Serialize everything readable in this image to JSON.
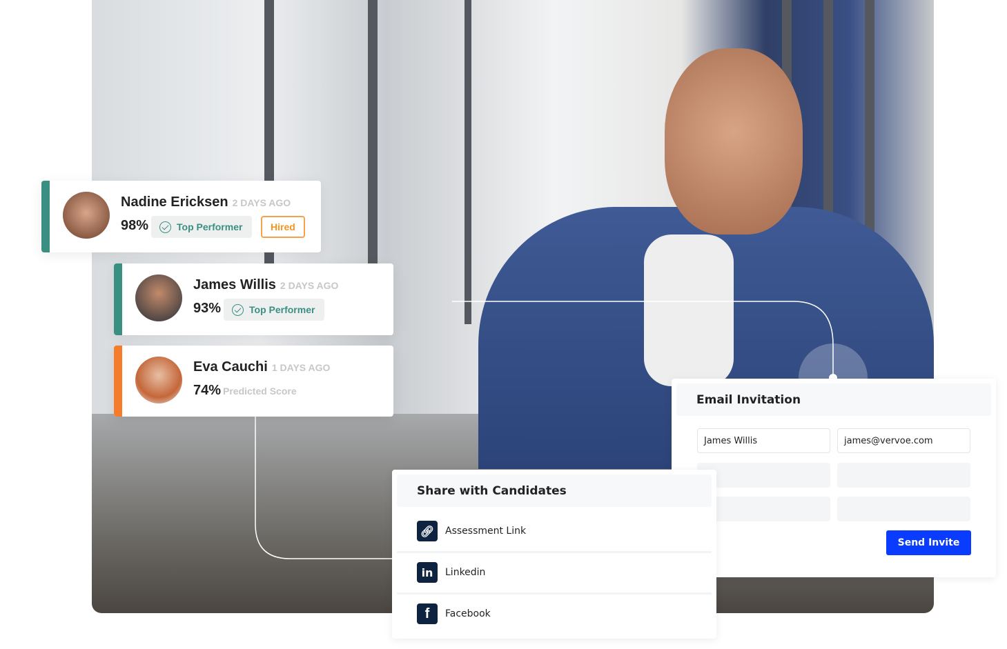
{
  "colors": {
    "teal": "#3a8f82",
    "orange": "#f57c2b",
    "hired": "#f7931e",
    "primary": "#0a3cff",
    "icon_bg": "#0d2340"
  },
  "candidates": [
    {
      "name": "Nadine Ericksen",
      "ago": "2 DAYS AGO",
      "score": "98%",
      "badge": "Top Performer",
      "status": "Hired",
      "accent": "#3a8f82"
    },
    {
      "name": "James Willis",
      "ago": "2 DAYS AGO",
      "score": "93%",
      "badge": "Top Performer",
      "accent": "#3a8f82"
    },
    {
      "name": "Eva Cauchi",
      "ago": "1 DAYS AGO",
      "score": "74%",
      "label": "Predicted Score",
      "accent": "#f57c2b"
    }
  ],
  "email": {
    "title": "Email Invitation",
    "name_value": "James Willis",
    "email_value": "james@vervoe.com",
    "send_label": "Send Invite"
  },
  "share": {
    "title": "Share with Candidates",
    "items": [
      {
        "label": "Assessment Link",
        "icon": "link-icon"
      },
      {
        "label": "Linkedin",
        "icon": "linkedin-icon"
      },
      {
        "label": "Facebook",
        "icon": "facebook-icon"
      }
    ]
  }
}
